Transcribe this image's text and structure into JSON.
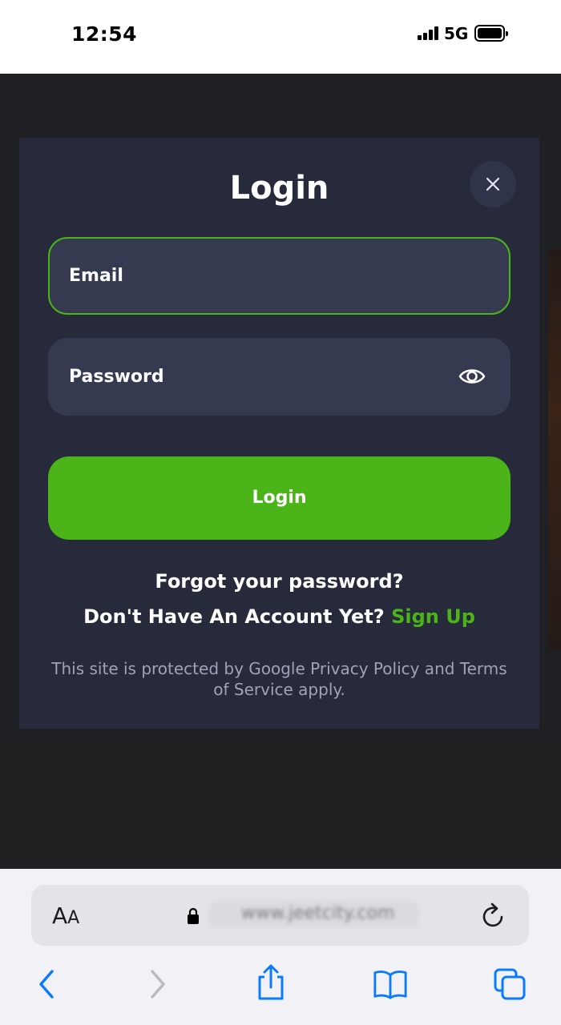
{
  "status_bar": {
    "time": "12:54",
    "network": "5G"
  },
  "modal": {
    "title": "Login",
    "close_icon": "close-icon",
    "email_placeholder": "Email",
    "password_placeholder": "Password",
    "show_password_icon": "eye-icon",
    "login_button": "Login",
    "forgot_password": "Forgot your password?",
    "no_account_text": "Don't Have An Account Yet?",
    "sign_up_link": "Sign Up",
    "legal_text": "This site is protected by Google Privacy Policy and Terms of Service apply."
  },
  "browser": {
    "text_size_label": "AA",
    "url": "www.jeetcity.com",
    "toolbar_icons": [
      "back-icon",
      "forward-icon",
      "share-icon",
      "bookmarks-icon",
      "tabs-icon"
    ]
  },
  "colors": {
    "accent": "#4ab419",
    "modal_background": "#262a3b",
    "field_background": "#353a50",
    "ios_blue": "#0a7aff"
  }
}
